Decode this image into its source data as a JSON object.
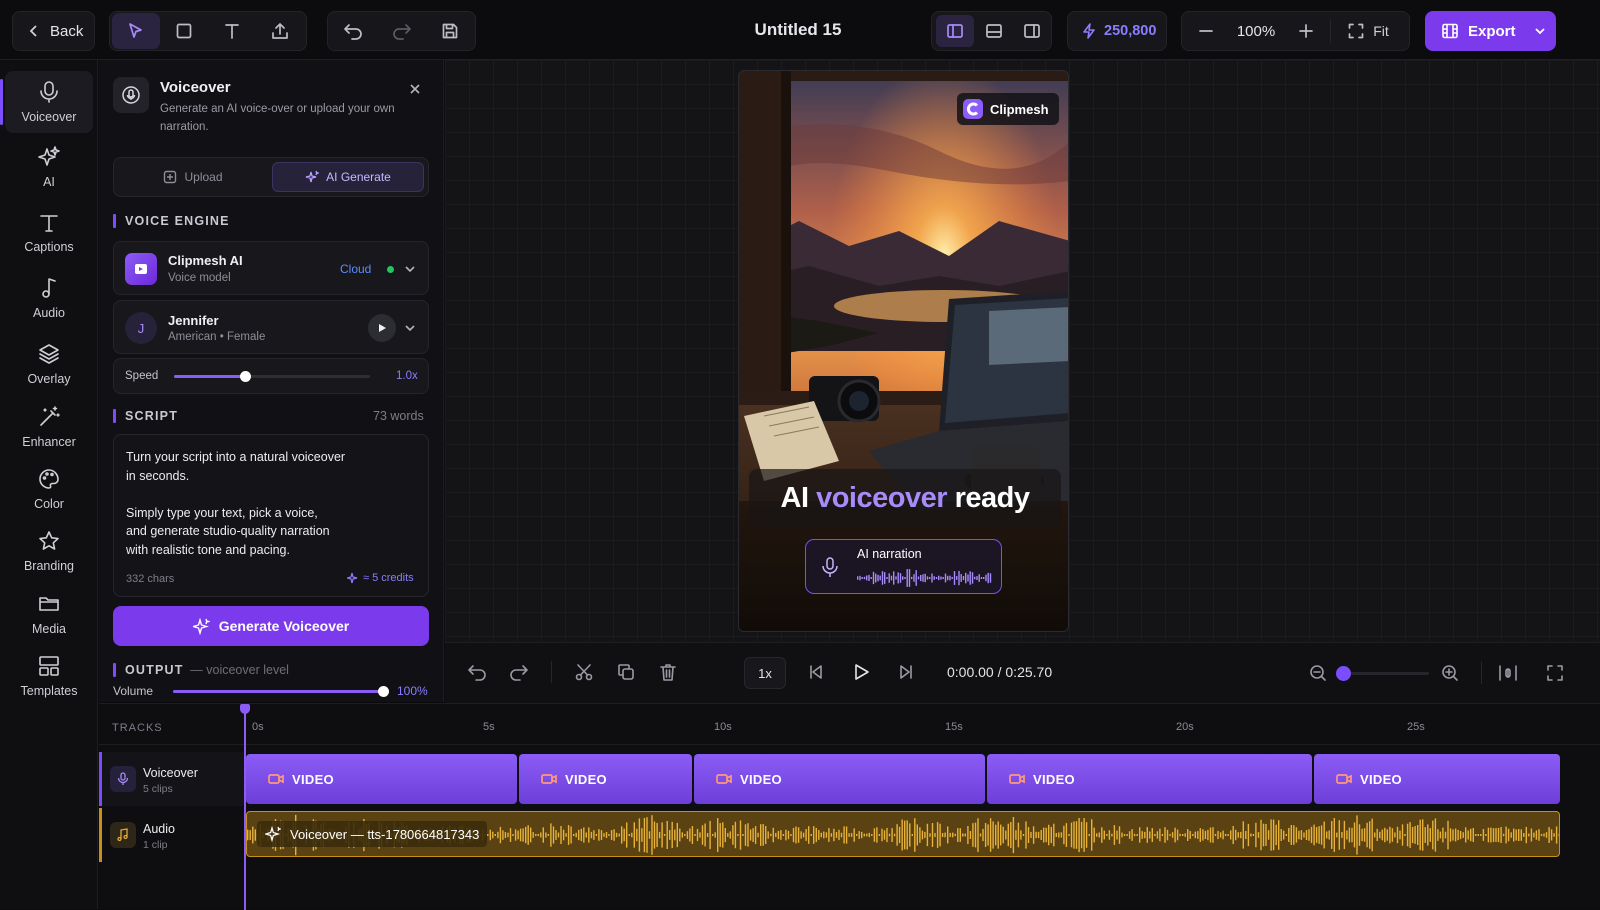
{
  "topbar": {
    "back_label": "Back",
    "title": "Untitled 15",
    "credits": "250,800",
    "zoom": "100%",
    "fit_label": "Fit",
    "export_label": "Export"
  },
  "rail": [
    {
      "label": "Voiceover",
      "icon": "mic-icon"
    },
    {
      "label": "AI",
      "icon": "sparkle-icon"
    },
    {
      "label": "Captions",
      "icon": "text-icon"
    },
    {
      "label": "Audio",
      "icon": "music-note-icon"
    },
    {
      "label": "Overlay",
      "icon": "layers-icon"
    },
    {
      "label": "Enhancer",
      "icon": "magic-wand-icon"
    },
    {
      "label": "Color",
      "icon": "palette-icon"
    },
    {
      "label": "Branding",
      "icon": "star-icon"
    },
    {
      "label": "Media",
      "icon": "folder-icon"
    },
    {
      "label": "Templates",
      "icon": "templates-icon"
    }
  ],
  "panel": {
    "title": "Voiceover",
    "description_line1": "Generate an AI voice-over or upload your own",
    "description_line2": "narration.",
    "tab_upload": "Upload",
    "tab_generate": "AI Generate",
    "voice_engine_label": "VOICE ENGINE",
    "engine": {
      "name": "Clipmesh AI",
      "sub": "Voice model",
      "badge": "Cloud"
    },
    "voice": {
      "initial": "J",
      "name": "Jennifer",
      "sub": "American • Female"
    },
    "speed": {
      "label": "Speed",
      "value": "1.0x",
      "fraction": 0.36
    },
    "script_label": "SCRIPT",
    "word_count": "73 words",
    "script_lines": [
      "Turn your script into a natural voiceover",
      "in seconds.",
      "",
      "Simply type your text, pick a voice,",
      "and generate studio-quality narration",
      "with realistic tone and pacing."
    ],
    "chars": "332 chars",
    "credits_cost": "≈ 5 credits",
    "generate_label": "Generate Voiceover",
    "output_label": "OUTPUT",
    "output_sub": "— voiceover level",
    "volume": {
      "label": "Volume",
      "value": "100%",
      "fraction": 1.0
    }
  },
  "preview": {
    "brand": "Clipmesh",
    "headline_a": "AI",
    "headline_b": "voiceover",
    "headline_c": "ready",
    "narration_label": "AI narration"
  },
  "controls": {
    "speed": "1x",
    "current_time": "0:00.00",
    "separator": "/",
    "duration": "0:25.70",
    "zoom_fraction": 0.0
  },
  "timeline": {
    "tracks_label": "TRACKS",
    "ruler": [
      "0s",
      "5s",
      "10s",
      "15s",
      "20s",
      "25s"
    ],
    "tracks": [
      {
        "name": "Voiceover",
        "sub": "5 clips"
      },
      {
        "name": "Audio",
        "sub": "1 clip"
      }
    ],
    "video_clips": [
      "VIDEO",
      "VIDEO",
      "VIDEO",
      "VIDEO",
      "VIDEO"
    ],
    "audio_clip": "Voiceover — tts-1780664817343"
  },
  "colors": {
    "accent": "#7c4dff",
    "audio": "#c7901a",
    "cloud": "#5b8cff",
    "online": "#22c55e"
  }
}
